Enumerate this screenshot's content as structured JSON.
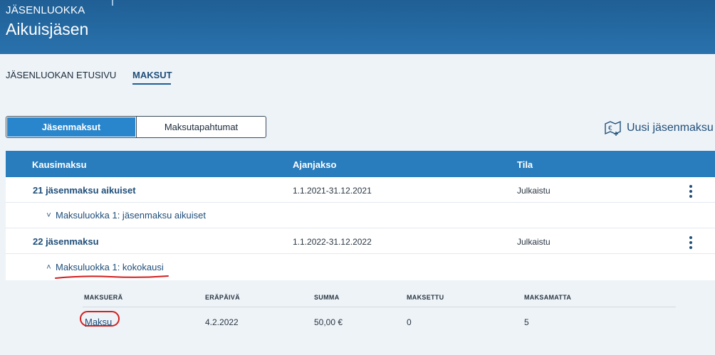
{
  "header": {
    "eyebrow": "JÄSENLUOKKA",
    "title": "Aikuisjäsen"
  },
  "nav": {
    "tabs": [
      {
        "label": "JÄSENLUOKAN ETUSIVU"
      },
      {
        "label": "MAKSUT"
      }
    ]
  },
  "toggle": {
    "left_label": "Jäsenmaksut",
    "right_label": "Maksutapahtumat"
  },
  "new_fee": {
    "label": "Uusi jäsenmaksu",
    "icon": "new-fee-icon"
  },
  "table": {
    "columns": [
      "Kausimaksu",
      "Ajanjakso",
      "Tila"
    ],
    "rows": [
      {
        "name": "21 jäsenmaksu aikuiset",
        "period": "1.1.2021-31.12.2021",
        "status": "Julkaistu",
        "category": {
          "label": "Maksuluokka 1: jäsenmaksu aikuiset",
          "chevron": "˅"
        }
      },
      {
        "name": "22 jäsenmaksu",
        "period": "1.1.2022-31.12.2022",
        "status": "Julkaistu",
        "category": {
          "label": "Maksuluokka 1: kokokausi",
          "chevron": "˄"
        }
      }
    ],
    "detail": {
      "columns": [
        "MAKSUERÄ",
        "ERÄPÄIVÄ",
        "SUMMA",
        "MAKSETTU",
        "MAKSAMATTA"
      ],
      "row": {
        "installment": "Maksu",
        "due": "4.2.2022",
        "sum": "50,00 €",
        "paid": "0",
        "unpaid": "5"
      }
    }
  },
  "colors": {
    "header_bg": "#1f5f95",
    "table_header_bg": "#2a7dbd",
    "accent": "#2a86cc",
    "link": "#1f4e79",
    "annotation": "#d21f1f"
  }
}
